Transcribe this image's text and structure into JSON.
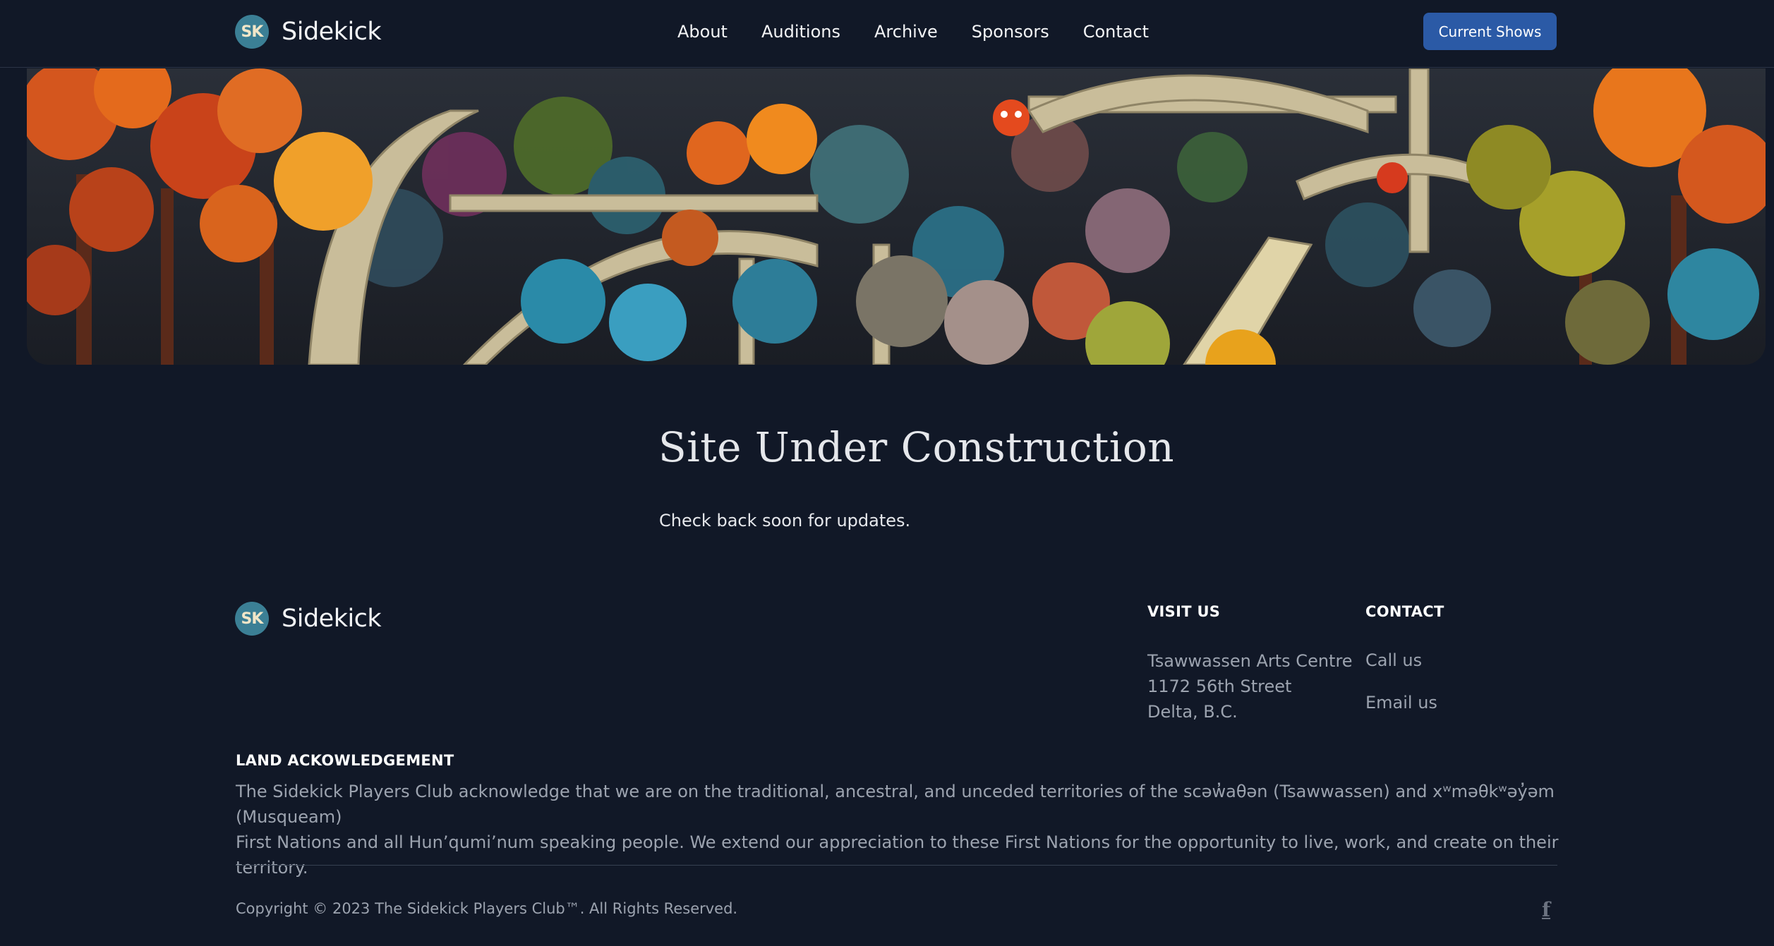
{
  "brand": {
    "initials": "SK",
    "name": "Sidekick",
    "badge_color": "#3b7f95"
  },
  "nav": {
    "items": [
      {
        "label": "About"
      },
      {
        "label": "Auditions"
      },
      {
        "label": "Archive"
      },
      {
        "label": "Sponsors"
      },
      {
        "label": "Contact"
      }
    ],
    "cta_label": "Current Shows",
    "cta_color": "#2b5aa6"
  },
  "hero": {
    "image_icon": "whimsical-forest-bridge-illustration"
  },
  "main": {
    "title": "Site Under Construction",
    "subtitle": "Check back soon for updates."
  },
  "footer": {
    "visit": {
      "title": "VISIT US",
      "lines": [
        "Tsawwassen Arts Centre",
        "1172 56th Street",
        "Delta, B.C."
      ]
    },
    "contact": {
      "title": "CONTACT",
      "call": "Call us",
      "email": "Email us"
    },
    "land": {
      "title": "LAND ACKOWLEDGEMENT",
      "line1": "The Sidekick Players Club acknowledge that we are on the traditional, ancestral, and unceded territories of the scəw̓aθən (Tsawwassen) and xʷməθkʷəy̓əm (Musqueam)",
      "line2": "First Nations and all Hun’qumi’num speaking people. We extend our appreciation to these First Nations for the opportunity to live, work, and create on their territory."
    },
    "copyright": "Copyright © 2023 The Sidekick Players Club™. All Rights Reserved.",
    "social_icon": "facebook-icon"
  },
  "colors": {
    "background": "#111827",
    "text_muted": "#9ca3af",
    "divider": "#374151"
  }
}
